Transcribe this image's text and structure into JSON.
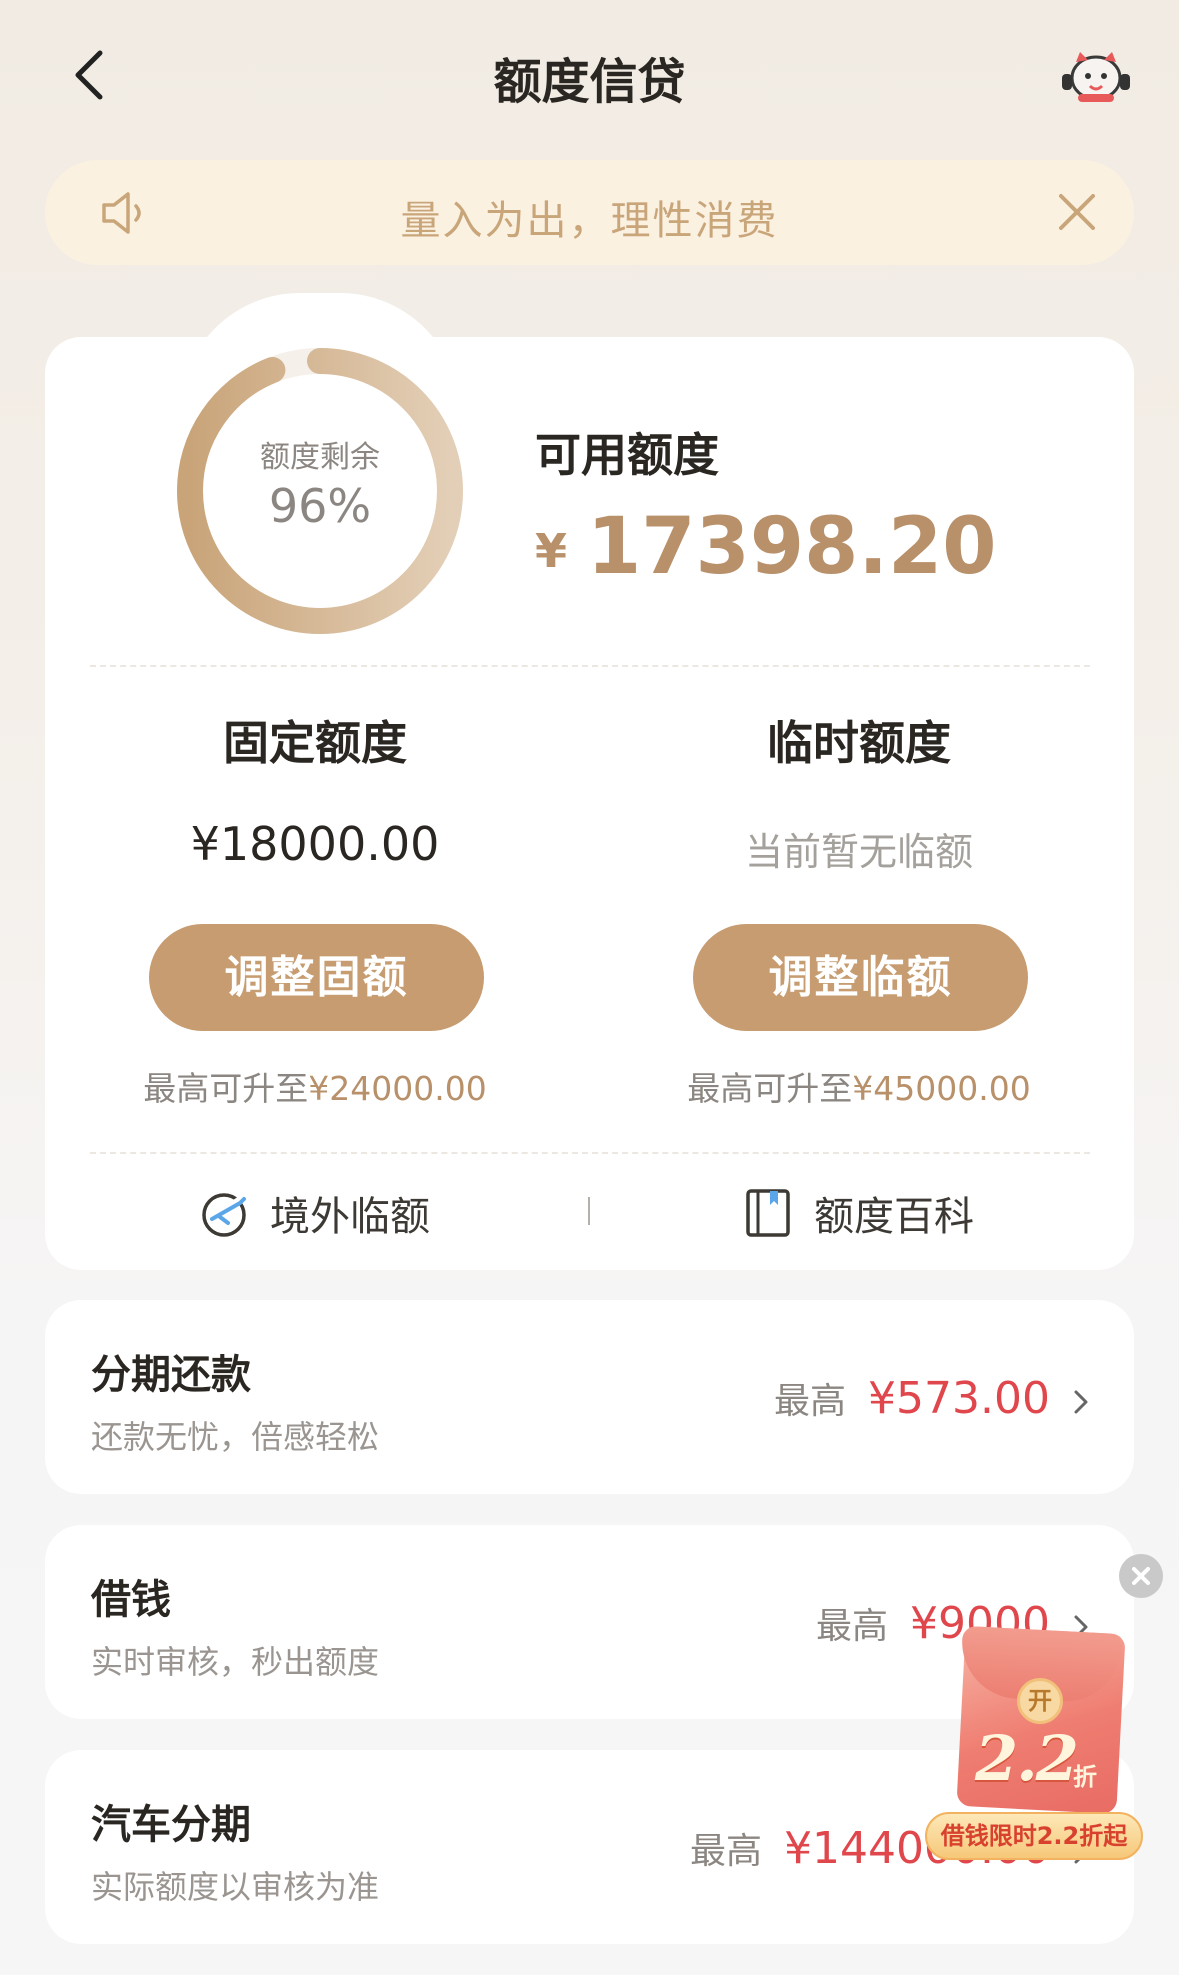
{
  "header": {
    "title": "额度信贷",
    "back_icon": "chevron-left-icon",
    "service_icon": "customer-service-mascot-icon"
  },
  "notice": {
    "text": "量入为出，理性消费",
    "icon": "speaker-icon",
    "close_icon": "close-icon"
  },
  "credit": {
    "ring_label": "额度剩余",
    "ring_percent": "96%",
    "remaining_fraction": 0.96,
    "available_label": "可用额度",
    "currency": "¥",
    "available_amount": "17398.20"
  },
  "fixed_limit": {
    "title": "固定额度",
    "amount": "¥18000.00",
    "button": "调整固额",
    "max_prefix": "最高可升至",
    "max_amount": "¥24000.00"
  },
  "temp_limit": {
    "title": "临时额度",
    "status": "当前暂无临额",
    "button": "调整临额",
    "max_prefix": "最高可升至",
    "max_amount": "¥45000.00"
  },
  "links": {
    "overseas": "境外临额",
    "overseas_icon": "plane-globe-icon",
    "encyclopedia": "额度百科",
    "encyclopedia_icon": "book-icon"
  },
  "products": [
    {
      "title": "分期还款",
      "subtitle": "还款无忧，倍感轻松",
      "max_label": "最高",
      "max_value": "¥573.00"
    },
    {
      "title": "借钱",
      "subtitle": "实时审核，秒出额度",
      "max_label": "最高",
      "max_value": "¥9000"
    },
    {
      "title": "汽车分期",
      "subtitle": "实际额度以审核为准",
      "max_label": "最高",
      "max_value": "¥144000.00"
    }
  ],
  "promo": {
    "seal": "开",
    "discount": "2.2",
    "unit": "折",
    "banner": "借钱限时2.2折起"
  },
  "colors": {
    "accent": "#c69c70",
    "amount_gold": "#b8906a",
    "price_red": "#e0474c",
    "notice_bg": "#fbf1e1"
  }
}
